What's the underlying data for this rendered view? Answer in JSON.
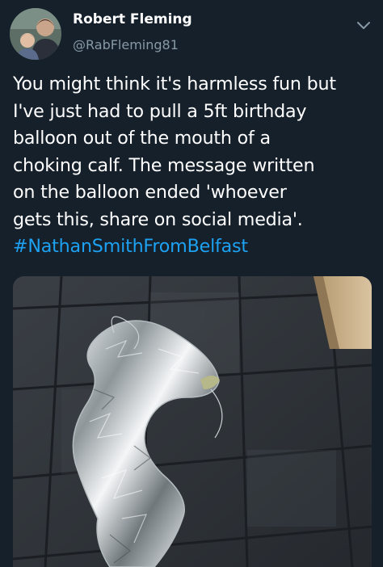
{
  "tweet": {
    "author_name": "Robert Fleming",
    "author_handle": "@RabFleming81",
    "text_lines": [
      "You might think it's harmless fun but",
      "I've just had to pull a 5ft birthday",
      "balloon out of the mouth of a",
      "choking calf. The message written",
      "on the balloon ended 'whoever",
      "gets this, share on social media'."
    ],
    "hashtag": "#NathanSmithFromBelfast"
  },
  "icons": {
    "menu": "chevron-down-icon",
    "avatar": "profile-photo"
  },
  "colors": {
    "background": "#15202b",
    "text": "#ffffff",
    "secondary_text": "#8899a6",
    "link": "#1da1f2"
  }
}
